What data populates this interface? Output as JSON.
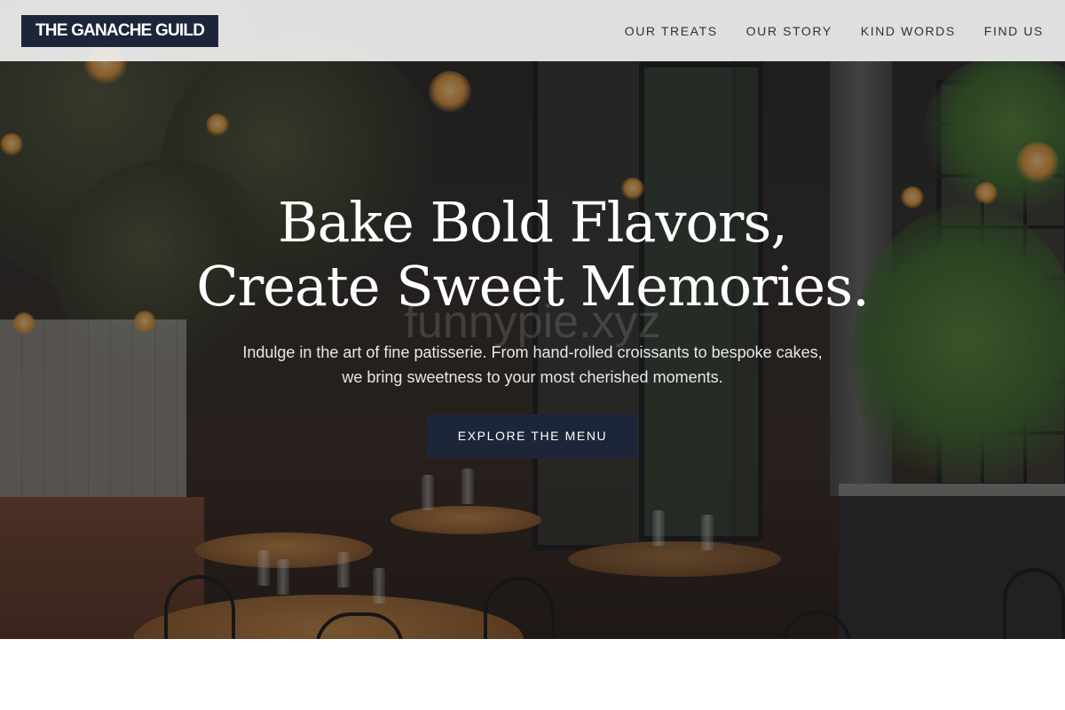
{
  "header": {
    "logo": "THE GANACHE GUILD",
    "nav": [
      {
        "label": "OUR TREATS"
      },
      {
        "label": "OUR STORY"
      },
      {
        "label": "KIND WORDS"
      },
      {
        "label": "FIND US"
      }
    ]
  },
  "hero": {
    "headline_line1": "Bake Bold Flavors,",
    "headline_line2": "Create Sweet Memories.",
    "watermark": "funnypie.xyz",
    "subtext": "Indulge in the art of fine patisserie. From hand-rolled croissants to bespoke cakes, we bring sweetness to your most cherished moments.",
    "cta_label": "EXPLORE THE MENU",
    "background": "restaurant-interior-photo"
  },
  "colors": {
    "brand_navy": "#1d2639",
    "header_bg": "#f0f0f0",
    "nav_text": "#2b3242",
    "hero_text": "#ffffff"
  }
}
